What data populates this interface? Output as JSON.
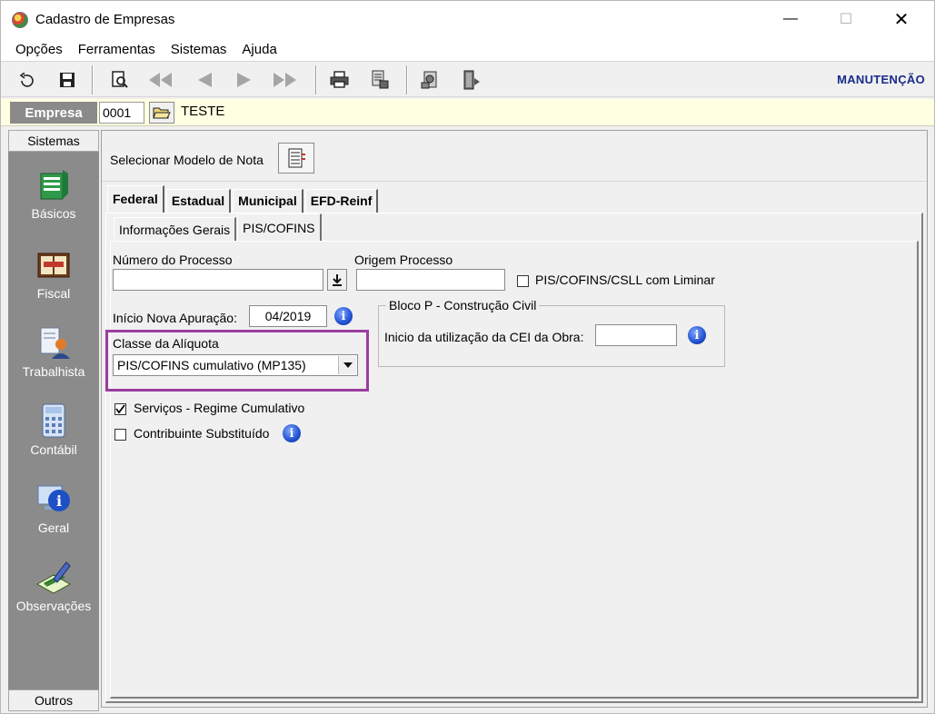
{
  "window": {
    "title": "Cadastro de Empresas",
    "minimize": "—",
    "maximize": "☐",
    "close": "✕"
  },
  "menu": [
    "Opções",
    "Ferramentas",
    "Sistemas",
    "Ajuda"
  ],
  "toolbar": {
    "mode_label": "MANUTENÇÃO",
    "icons": [
      "undo-icon",
      "save-icon",
      "preview-icon",
      "first-record-icon",
      "previous-record-icon",
      "next-record-icon",
      "last-record-icon",
      "print-icon",
      "report-icon",
      "tools-icon",
      "exit-door-icon"
    ]
  },
  "empresa": {
    "label": "Empresa",
    "code": "0001",
    "name": "TESTE"
  },
  "sidebar": {
    "header": "Sistemas",
    "footer": "Outros",
    "items": [
      {
        "label": "Básicos",
        "icon": "basicos-icon"
      },
      {
        "label": "Fiscal",
        "icon": "fiscal-icon"
      },
      {
        "label": "Trabalhista",
        "icon": "trabalhista-icon"
      },
      {
        "label": "Contábil",
        "icon": "calculator-icon"
      },
      {
        "label": "Geral",
        "icon": "info-computer-icon"
      },
      {
        "label": "Observações",
        "icon": "pen-notes-icon"
      }
    ]
  },
  "main": {
    "modelo_label": "Selecionar Modelo de Nota",
    "tabs": [
      "Federal",
      "Estadual",
      "Municipal",
      "EFD-Reinf"
    ],
    "active_tab": "Federal",
    "subtabs": [
      "Informações Gerais",
      "PIS/COFINS"
    ],
    "active_subtab": "PIS/COFINS",
    "form": {
      "numero_processo_label": "Número do Processo",
      "numero_processo_value": "",
      "origem_processo_label": "Origem Processo",
      "origem_processo_value": "",
      "liminar_label": "PIS/COFINS/CSLL com Liminar",
      "liminar_checked": false,
      "inicio_apuracao_label": "Início Nova Apuração:",
      "inicio_apuracao_value": "04/2019",
      "classe_aliquota_label": "Classe da Alíquota",
      "classe_aliquota_value": "PIS/COFINS cumulativo (MP135)",
      "bloco_p_title": "Bloco P - Construção Civil",
      "inicio_cei_label": "Inicio da utilização da CEI da Obra:",
      "inicio_cei_value": "",
      "servicos_label": "Serviços - Regime Cumulativo",
      "servicos_checked": true,
      "contribuinte_label": "Contribuinte Substituído",
      "contribuinte_checked": false
    }
  },
  "colors": {
    "highlight_border": "#9b3d9f",
    "empresa_bar_bg": "#ffffe1",
    "sidebar_bg": "#8b8b8b",
    "mode_label_color": "#1a2a8a"
  }
}
